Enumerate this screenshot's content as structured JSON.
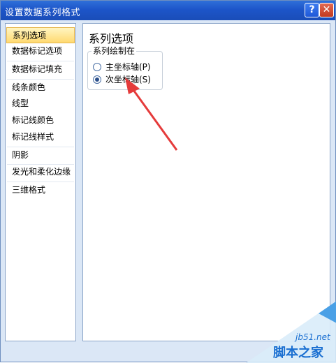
{
  "window": {
    "title": "设置数据系列格式"
  },
  "titlebar_buttons": {
    "help": "?",
    "close": "✕"
  },
  "nav": {
    "items": [
      {
        "label": "系列选项",
        "selected": true
      },
      {
        "label": "数据标记选项",
        "selected": false
      },
      {
        "label": "数据标记填充",
        "selected": false
      },
      {
        "label": "线条颜色",
        "selected": false
      },
      {
        "label": "线型",
        "selected": false
      },
      {
        "label": "标记线颜色",
        "selected": false
      },
      {
        "label": "标记线样式",
        "selected": false
      },
      {
        "label": "阴影",
        "selected": false
      },
      {
        "label": "发光和柔化边缘",
        "selected": false
      },
      {
        "label": "三维格式",
        "selected": false
      }
    ]
  },
  "content": {
    "title": "系列选项",
    "group_label": "系列绘制在",
    "options": [
      {
        "label": "主坐标轴(P)",
        "checked": false
      },
      {
        "label": "次坐标轴(S)",
        "checked": true
      }
    ]
  },
  "annotation": {
    "arrow_color": "#e53b3b"
  },
  "watermark": {
    "site": "jb51.net",
    "brand": "脚本之家"
  },
  "colors": {
    "accent": "#1d55c9",
    "selected_bg": "#ffd970"
  }
}
